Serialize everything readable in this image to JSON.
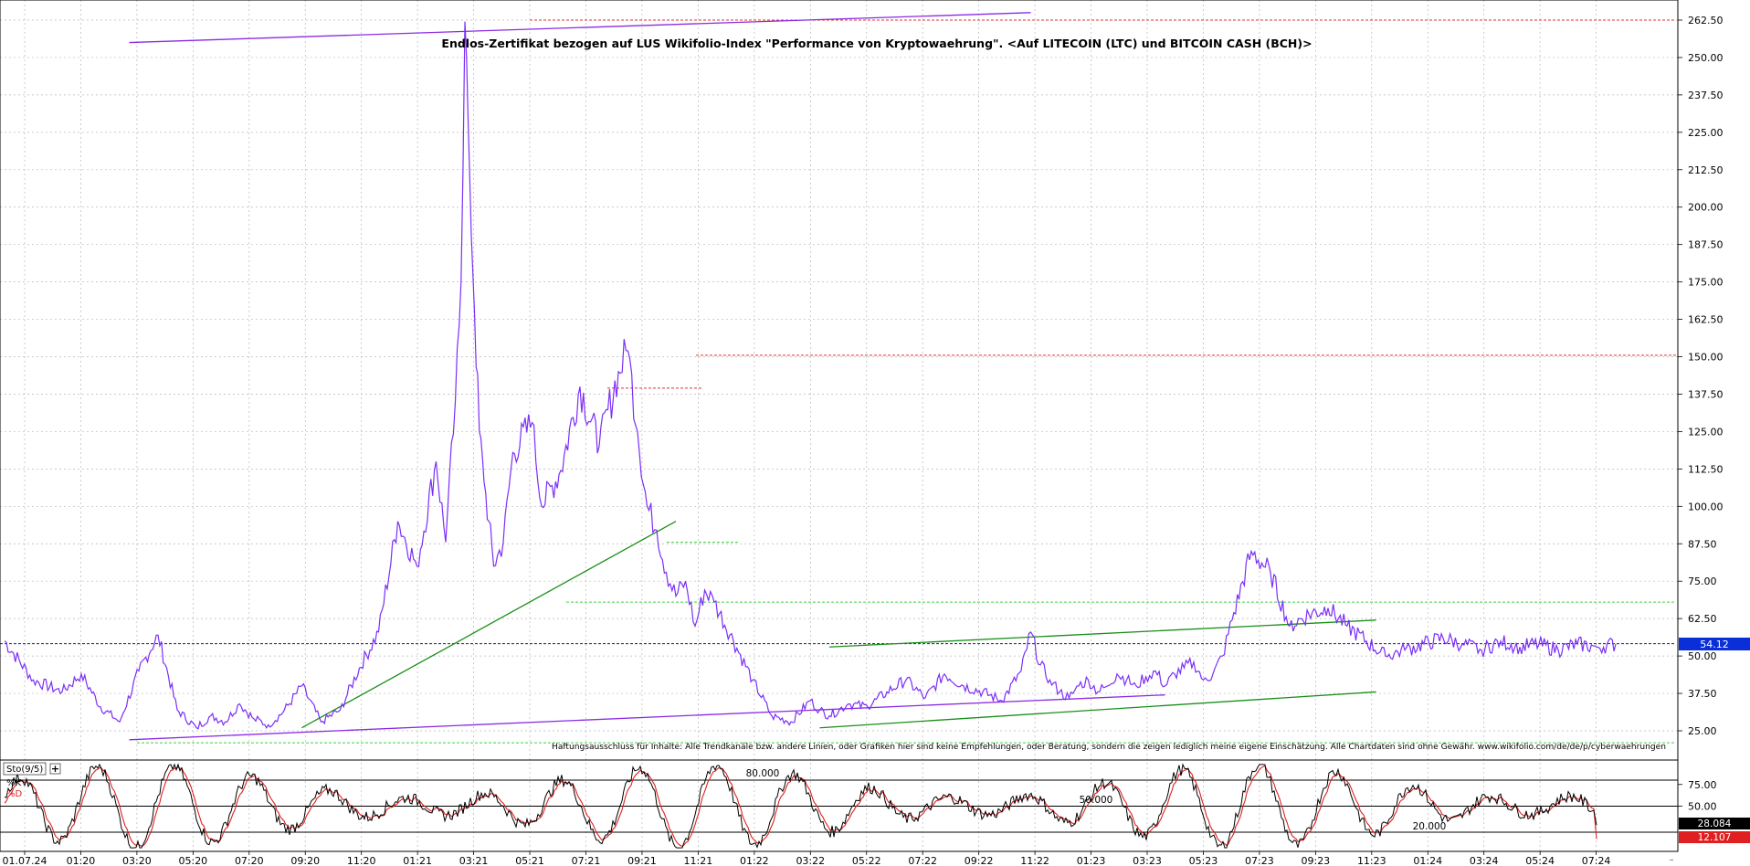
{
  "chart_data": [
    {
      "type": "line",
      "title": "Endlos-Zertifikat bezogen auf LUS Wikifolio-Index \"Performance von Kryptowaehrung\". <Auf LITECOIN (LTC) und BITCOIN CASH (BCH)>",
      "disclaimer": "Haftungsausschluss für Inhalte: Alle Trendkanäle bzw. andere Linien, oder Grafiken hier sind keine Empfehlungen, oder Beratung, sondern die zeigen lediglich meine eigene Einschätzung. Alle Chartdaten sind ohne Gewähr. www.wikifolio.com/de/de/p/cyberwaehrungen",
      "x_tick_labels": [
        "01.07.24",
        "01:20",
        "03:20",
        "05:20",
        "07:20",
        "09:20",
        "11:20",
        "01:21",
        "03:21",
        "05:21",
        "07:21",
        "09:21",
        "11:21",
        "01:22",
        "03:22",
        "05:22",
        "07:22",
        "09:22",
        "11:22",
        "01:23",
        "03:23",
        "05:23",
        "07:23",
        "09:23",
        "11:23",
        "01:24",
        "03:24",
        "05:24",
        "07:24"
      ],
      "y_tick_labels": [
        "262.50",
        "250.00",
        "237.50",
        "225.00",
        "212.50",
        "200.00",
        "187.50",
        "175.00",
        "162.50",
        "150.00",
        "137.50",
        "125.00",
        "112.50",
        "100.00",
        "87.50",
        "75.00",
        "62.50",
        "50.00",
        "37.50",
        "25.00"
      ],
      "ylim": [
        20,
        265
      ],
      "last_value_label": "54.12",
      "last_value": 54.12,
      "series": [
        {
          "color": "#7b2ff7",
          "x": [
            0,
            3,
            6,
            8,
            10,
            12,
            14,
            16,
            18,
            20,
            21.5,
            23,
            24.5,
            26,
            27.5,
            29,
            31,
            33,
            35,
            37,
            39,
            41,
            43,
            45,
            46,
            47,
            47.6,
            48,
            48.5,
            49,
            49.5,
            50,
            50.5,
            51,
            52,
            53,
            55,
            56,
            58,
            60,
            62,
            64,
            65,
            66,
            67,
            68,
            69,
            70,
            71,
            72,
            73,
            74,
            76,
            78,
            80,
            82,
            84,
            85,
            86,
            88,
            90,
            92,
            94,
            96,
            98,
            100,
            102,
            104,
            106,
            107,
            108,
            109,
            110,
            111,
            112,
            113,
            114,
            115,
            116,
            117,
            118,
            119,
            120,
            121,
            122,
            123,
            124,
            125,
            126,
            127,
            128,
            130,
            132,
            134,
            136,
            138,
            140,
            142,
            144,
            146,
            148,
            150,
            152,
            154,
            156,
            158,
            160,
            162,
            164,
            166,
            168
          ],
          "y": [
            55,
            42,
            38,
            44,
            33,
            28,
            45,
            57,
            32,
            26,
            30,
            28,
            34,
            29,
            27,
            31,
            40,
            28,
            32,
            46,
            58,
            95,
            80,
            115,
            88,
            135,
            175,
            262,
            210,
            165,
            125,
            108,
            95,
            80,
            88,
            118,
            128,
            100,
            112,
            140,
            120,
            145,
            152,
            125,
            100,
            92,
            78,
            70,
            75,
            60,
            72,
            68,
            55,
            42,
            30,
            28,
            35,
            32,
            30,
            34,
            33,
            38,
            42,
            36,
            44,
            40,
            38,
            35,
            45,
            58,
            47,
            42,
            38,
            36,
            40,
            42,
            38,
            40,
            44,
            42,
            40,
            43,
            45,
            40,
            44,
            46,
            48,
            42,
            44,
            50,
            62,
            85,
            78,
            60,
            64,
            66,
            60,
            55,
            50,
            52,
            54,
            56,
            54,
            52,
            55,
            53,
            54,
            52,
            54,
            53,
            54
          ]
        }
      ],
      "trendlines": [
        {
          "color": "#8a2be2",
          "x": [
            13,
            121
          ],
          "y": [
            22,
            37
          ]
        },
        {
          "color": "#8a2be2",
          "x": [
            13,
            107
          ],
          "y": [
            255,
            265
          ]
        },
        {
          "color": "#1a8f1a",
          "x": [
            31,
            70
          ],
          "y": [
            26,
            95
          ]
        },
        {
          "color": "#1a8f1a",
          "x": [
            86,
            143
          ],
          "y": [
            53,
            62
          ]
        },
        {
          "color": "#1a8f1a",
          "x": [
            85,
            143
          ],
          "y": [
            26,
            38
          ]
        }
      ],
      "hlines": [
        {
          "color": "#e23030",
          "y": 262.5,
          "style": "dotted"
        },
        {
          "color": "#e23030",
          "y": 150.5,
          "style": "dotted"
        },
        {
          "color": "#e23030",
          "y": 139.5,
          "style": "dotted"
        },
        {
          "color": "#3ed13e",
          "y": 88,
          "style": "dotted"
        },
        {
          "color": "#3ed13e",
          "y": 68,
          "style": "dotted"
        },
        {
          "color": "#1a1a6e",
          "y": 54.12,
          "style": "dotted"
        },
        {
          "color": "#3ed13e",
          "y": 21,
          "style": "dotted"
        }
      ],
      "grid": true
    },
    {
      "type": "line",
      "title": "Sto(9/5)",
      "legend": [
        {
          "name": "%K",
          "color": "#000000"
        },
        {
          "name": "%D",
          "color": "#e02020"
        }
      ],
      "ylim": [
        0,
        100
      ],
      "y_tick_labels": [
        "75.00",
        "50.00"
      ],
      "level_labels": [
        "80.000",
        "50.000",
        "20.000"
      ],
      "levels": [
        80,
        50,
        20
      ],
      "last_values": {
        "K": 28.084,
        "D": 12.107
      },
      "last_value_labels": [
        "28.084",
        "12.107"
      ],
      "grid": true
    }
  ]
}
